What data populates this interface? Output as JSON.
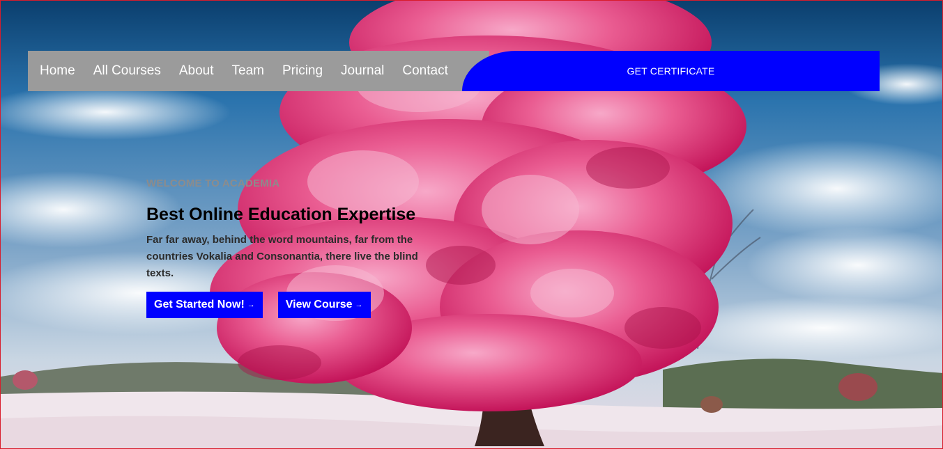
{
  "nav": {
    "items": [
      {
        "label": "Home"
      },
      {
        "label": "All Courses"
      },
      {
        "label": "About"
      },
      {
        "label": "Team"
      },
      {
        "label": "Pricing"
      },
      {
        "label": "Journal"
      },
      {
        "label": "Contact"
      }
    ],
    "cta_label": "GET CERTIFICATE"
  },
  "hero": {
    "eyebrow": "WELCOME TO ACADEMIA",
    "title": "Best Online Education Expertise",
    "description": "Far far away, behind the word mountains, far from the countries Vokalia and Consonantia, there live the blind texts.",
    "primary_button": "Get Started Now!",
    "secondary_button": "View Course",
    "arrow_icon": "→"
  },
  "colors": {
    "nav_bg": "#9b9b9b",
    "accent_blue": "#0000ff",
    "frame_border": "#d81c2b",
    "tree_pink": "#e8457f"
  }
}
